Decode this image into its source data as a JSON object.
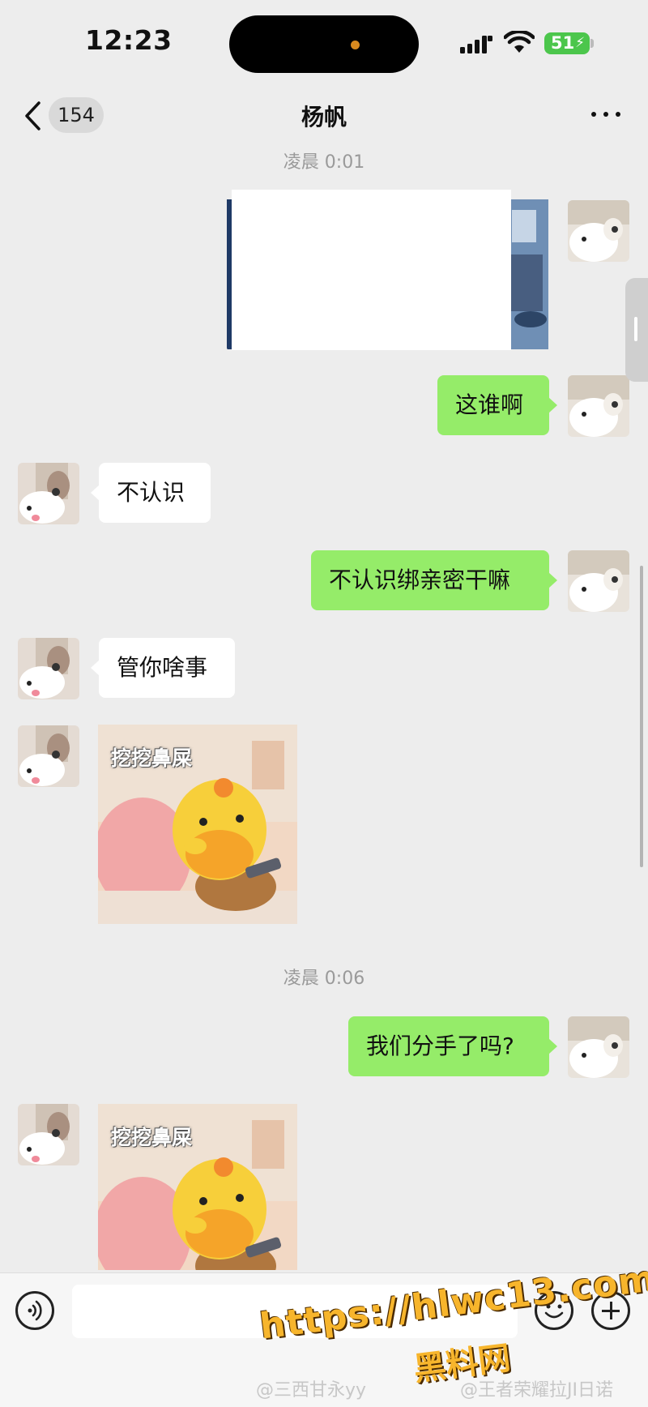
{
  "status_bar": {
    "time": "12:23",
    "battery": "51"
  },
  "nav": {
    "unread_count": "154",
    "title": "杨帆"
  },
  "messages": [
    {
      "type": "timestamp",
      "text": "凌晨 0:01"
    },
    {
      "type": "image",
      "side": "right",
      "content": "partially hidden screenshot"
    },
    {
      "type": "text",
      "side": "right",
      "text": "这谁啊"
    },
    {
      "type": "text",
      "side": "left",
      "text": "不认识"
    },
    {
      "type": "text",
      "side": "right",
      "text": "不认识绑亲密干嘛"
    },
    {
      "type": "text",
      "side": "left",
      "text": "管你啥事"
    },
    {
      "type": "sticker",
      "side": "left",
      "caption": "挖挖鼻屎"
    },
    {
      "type": "timestamp",
      "text": "凌晨 0:06"
    },
    {
      "type": "text",
      "side": "right",
      "text": "我们分手了吗?"
    },
    {
      "type": "sticker",
      "side": "left",
      "caption": "挖挖鼻屎"
    }
  ],
  "input_bar": {
    "voice_icon": "voice-icon",
    "emoji_icon": "emoji-icon",
    "plus_icon": "plus-icon"
  },
  "watermark": {
    "url": "https://hlwc13.com",
    "site": "黑料网",
    "weibo_1": "@三西甘永yy",
    "weibo_2": "@王者荣耀拉JI日诺"
  },
  "colors": {
    "background": "#ededed",
    "bubble_right": "#95ec69",
    "bubble_left": "#ffffff",
    "battery": "#4cc64c",
    "watermark": "#f7b52c"
  }
}
